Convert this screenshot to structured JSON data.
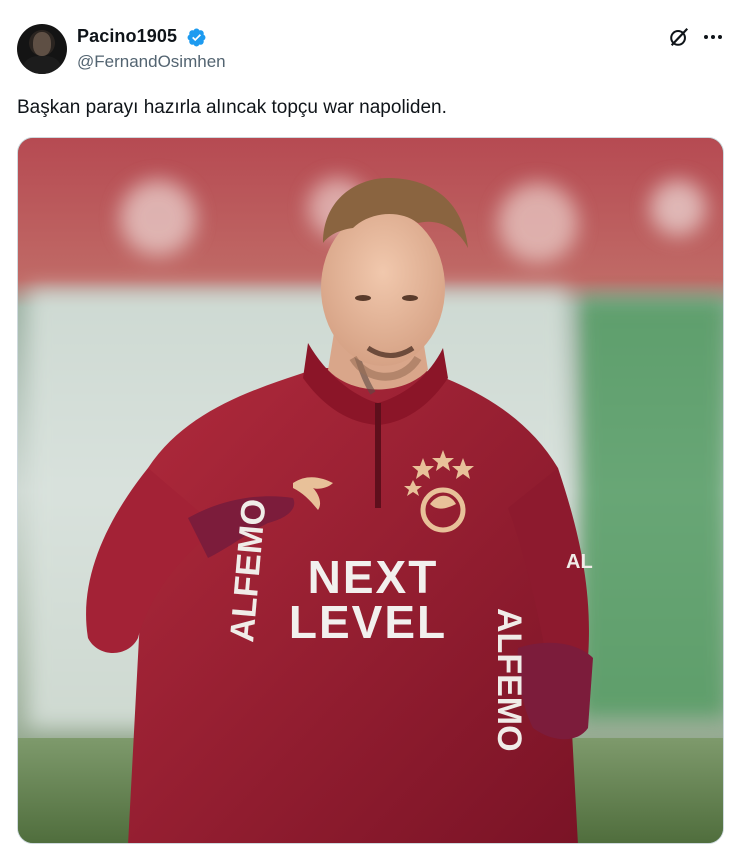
{
  "author": {
    "display_name": "Pacino1905",
    "handle": "@FernandOsimhen",
    "verified": true
  },
  "tweet": {
    "text": "Başkan parayı hazırla alıncak topçu war napoliden."
  },
  "media": {
    "kind": "photo",
    "jersey_text_line1": "NEXT",
    "jersey_text_line2": "LEVEL",
    "sleeve_left_text": "ALFEMO",
    "sleeve_right_text": "ALFEMO",
    "shoulder_text": "AL"
  },
  "icons": {
    "verified": "verified-badge-icon",
    "grok": "grok-icon",
    "more": "more-options-icon"
  },
  "colors": {
    "verified_blue": "#1d9bf0",
    "handle_gray": "#536471",
    "jersey_red": "#9b1b30",
    "jersey_dark": "#7a1326"
  }
}
